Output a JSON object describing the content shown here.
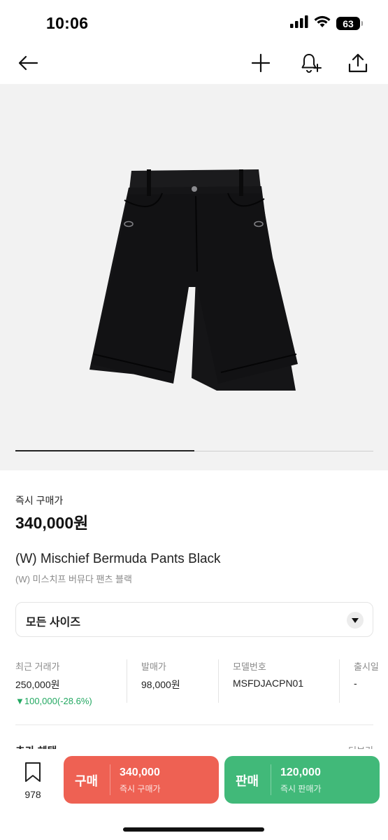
{
  "status_bar": {
    "time": "10:06",
    "battery": "63",
    "icons": [
      "signal-icon",
      "wifi-icon",
      "battery-icon"
    ]
  },
  "header": {
    "icons": [
      "back-arrow-icon",
      "plus-icon",
      "bell-plus-icon",
      "share-icon"
    ]
  },
  "gallery": {
    "image": "black bermuda shorts",
    "progress": 0.5
  },
  "price": {
    "label": "즉시 구매가",
    "value": "340,000원"
  },
  "product": {
    "title_en": "(W) Mischief Bermuda Pants Black",
    "title_ko": "(W) 미스치프 버뮤다 팬츠 블랙"
  },
  "size_select": {
    "label": "모든 사이즈",
    "icon": "chevron-down-icon"
  },
  "info": [
    {
      "label": "최근 거래가",
      "value": "250,000원",
      "change": "▼100,000(-28.6%)"
    },
    {
      "label": "발매가",
      "value": "98,000원"
    },
    {
      "label": "모델번호",
      "value": "MSFDJACPN01"
    },
    {
      "label": "출시일",
      "value": "-"
    }
  ],
  "partial_section": {
    "left": "추가 혜택",
    "right": "더보기"
  },
  "bottom_bar": {
    "wishlist_count": "978",
    "buy": {
      "label": "구매",
      "price": "340,000",
      "sub": "즉시 구매가"
    },
    "sell": {
      "label": "판매",
      "price": "120,000",
      "sub": "즉시 판매가"
    }
  },
  "colors": {
    "buy": "#ee6153",
    "sell": "#41b979",
    "price_down": "#22a861"
  }
}
